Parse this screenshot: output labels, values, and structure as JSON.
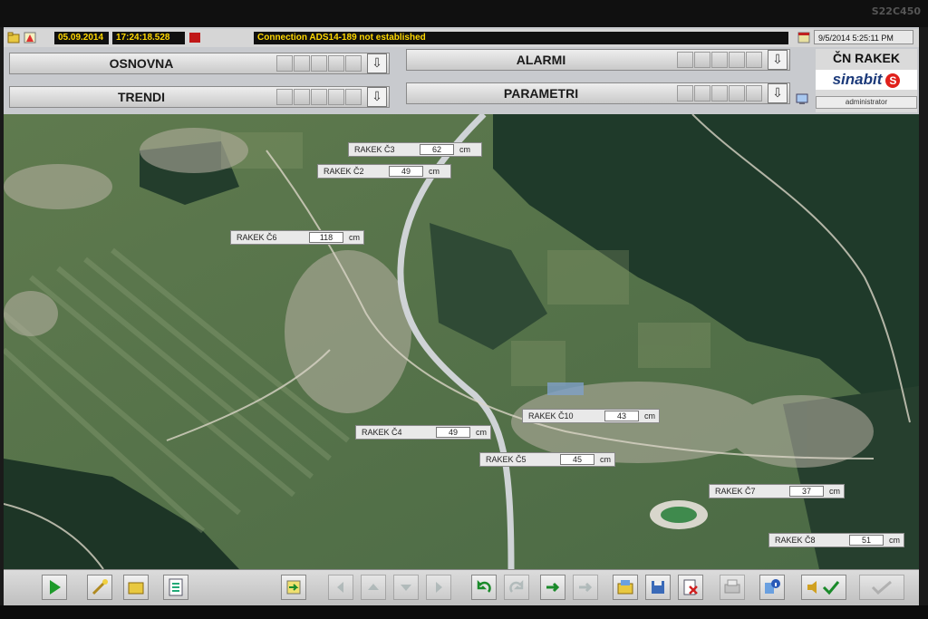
{
  "monitor": {
    "model": "S22C450"
  },
  "statusbar": {
    "date": "05.09.2014",
    "time": "17:24:18.528",
    "message": "Connection ADS14-189 not established",
    "datetime": "9/5/2014 5:25:11 PM"
  },
  "nav": {
    "osnovna": "OSNOVNA",
    "trendi": "TRENDI",
    "alarmi": "ALARMI",
    "parametri": "PARAMETRI"
  },
  "brand": {
    "title": "ČN RAKEK",
    "logo": "sinabit",
    "logo_mark": "S",
    "user": "administrator"
  },
  "stations": [
    {
      "name": "RAKEK Č3",
      "value": "62",
      "unit": "cm"
    },
    {
      "name": "RAKEK Č2",
      "value": "49",
      "unit": "cm"
    },
    {
      "name": "RAKEK Č6",
      "value": "118",
      "unit": "cm"
    },
    {
      "name": "RAKEK Č10",
      "value": "43",
      "unit": "cm"
    },
    {
      "name": "RAKEK Č4",
      "value": "49",
      "unit": "cm"
    },
    {
      "name": "RAKEK Č5",
      "value": "45",
      "unit": "cm"
    },
    {
      "name": "RAKEK Č7",
      "value": "37",
      "unit": "cm"
    },
    {
      "name": "RAKEK Č8",
      "value": "51",
      "unit": "cm"
    }
  ],
  "icons": {
    "play": "play-icon",
    "wand": "wand-icon",
    "folder": "folder-icon",
    "list": "list-icon",
    "export": "export-icon",
    "left": "arrow-left-icon",
    "up": "arrow-up-icon",
    "down": "arrow-down-icon",
    "right": "arrow-right-icon",
    "undo": "undo-icon",
    "redo": "redo-icon",
    "run": "run-icon",
    "forward": "forward-icon",
    "open": "open-icon",
    "save": "save-icon",
    "delete": "delete-icon",
    "printer": "printer-icon",
    "info": "info-icon",
    "sound": "sound-icon",
    "check": "check-icon"
  }
}
